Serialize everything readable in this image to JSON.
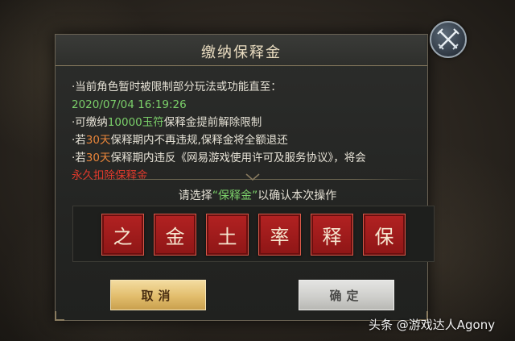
{
  "dialog": {
    "title": "缴纳保释金",
    "lines": [
      [
        {
          "t": "·当前角色暂时被限制部分玩法或功能直至：",
          "c": ""
        }
      ],
      [
        {
          "t": "2020/07/04 16:19:26",
          "c": "green"
        }
      ],
      [
        {
          "t": "·可缴纳",
          "c": ""
        },
        {
          "t": "10000玉符",
          "c": "green"
        },
        {
          "t": "保释金提前解除限制",
          "c": ""
        }
      ],
      [
        {
          "t": "·若",
          "c": ""
        },
        {
          "t": "30天",
          "c": "orange"
        },
        {
          "t": "保释期内不再违规,保释金将全额退还",
          "c": ""
        }
      ],
      [
        {
          "t": "·若",
          "c": ""
        },
        {
          "t": "30天",
          "c": "orange"
        },
        {
          "t": "保释期内违反《网易游戏使用许可及服务协议》，将会",
          "c": ""
        }
      ],
      [
        {
          "t": "永久扣除保释金",
          "c": "red"
        }
      ]
    ],
    "prompt_prefix": "请选择",
    "prompt_highlight": "“保释金”",
    "prompt_suffix": "以确认本次操作",
    "tiles": [
      "之",
      "金",
      "土",
      "率",
      "释",
      "保"
    ],
    "cancel_label": "取消",
    "confirm_label": "确定"
  },
  "watermark": "头条 @游戏达人Agony",
  "colors": {
    "highlight_green": "#7bd06a",
    "highlight_orange": "#e8853a",
    "highlight_red": "#e23a2c",
    "tile_red": "#a81d1d"
  },
  "icons": {
    "close": "crossed-swords-icon"
  }
}
